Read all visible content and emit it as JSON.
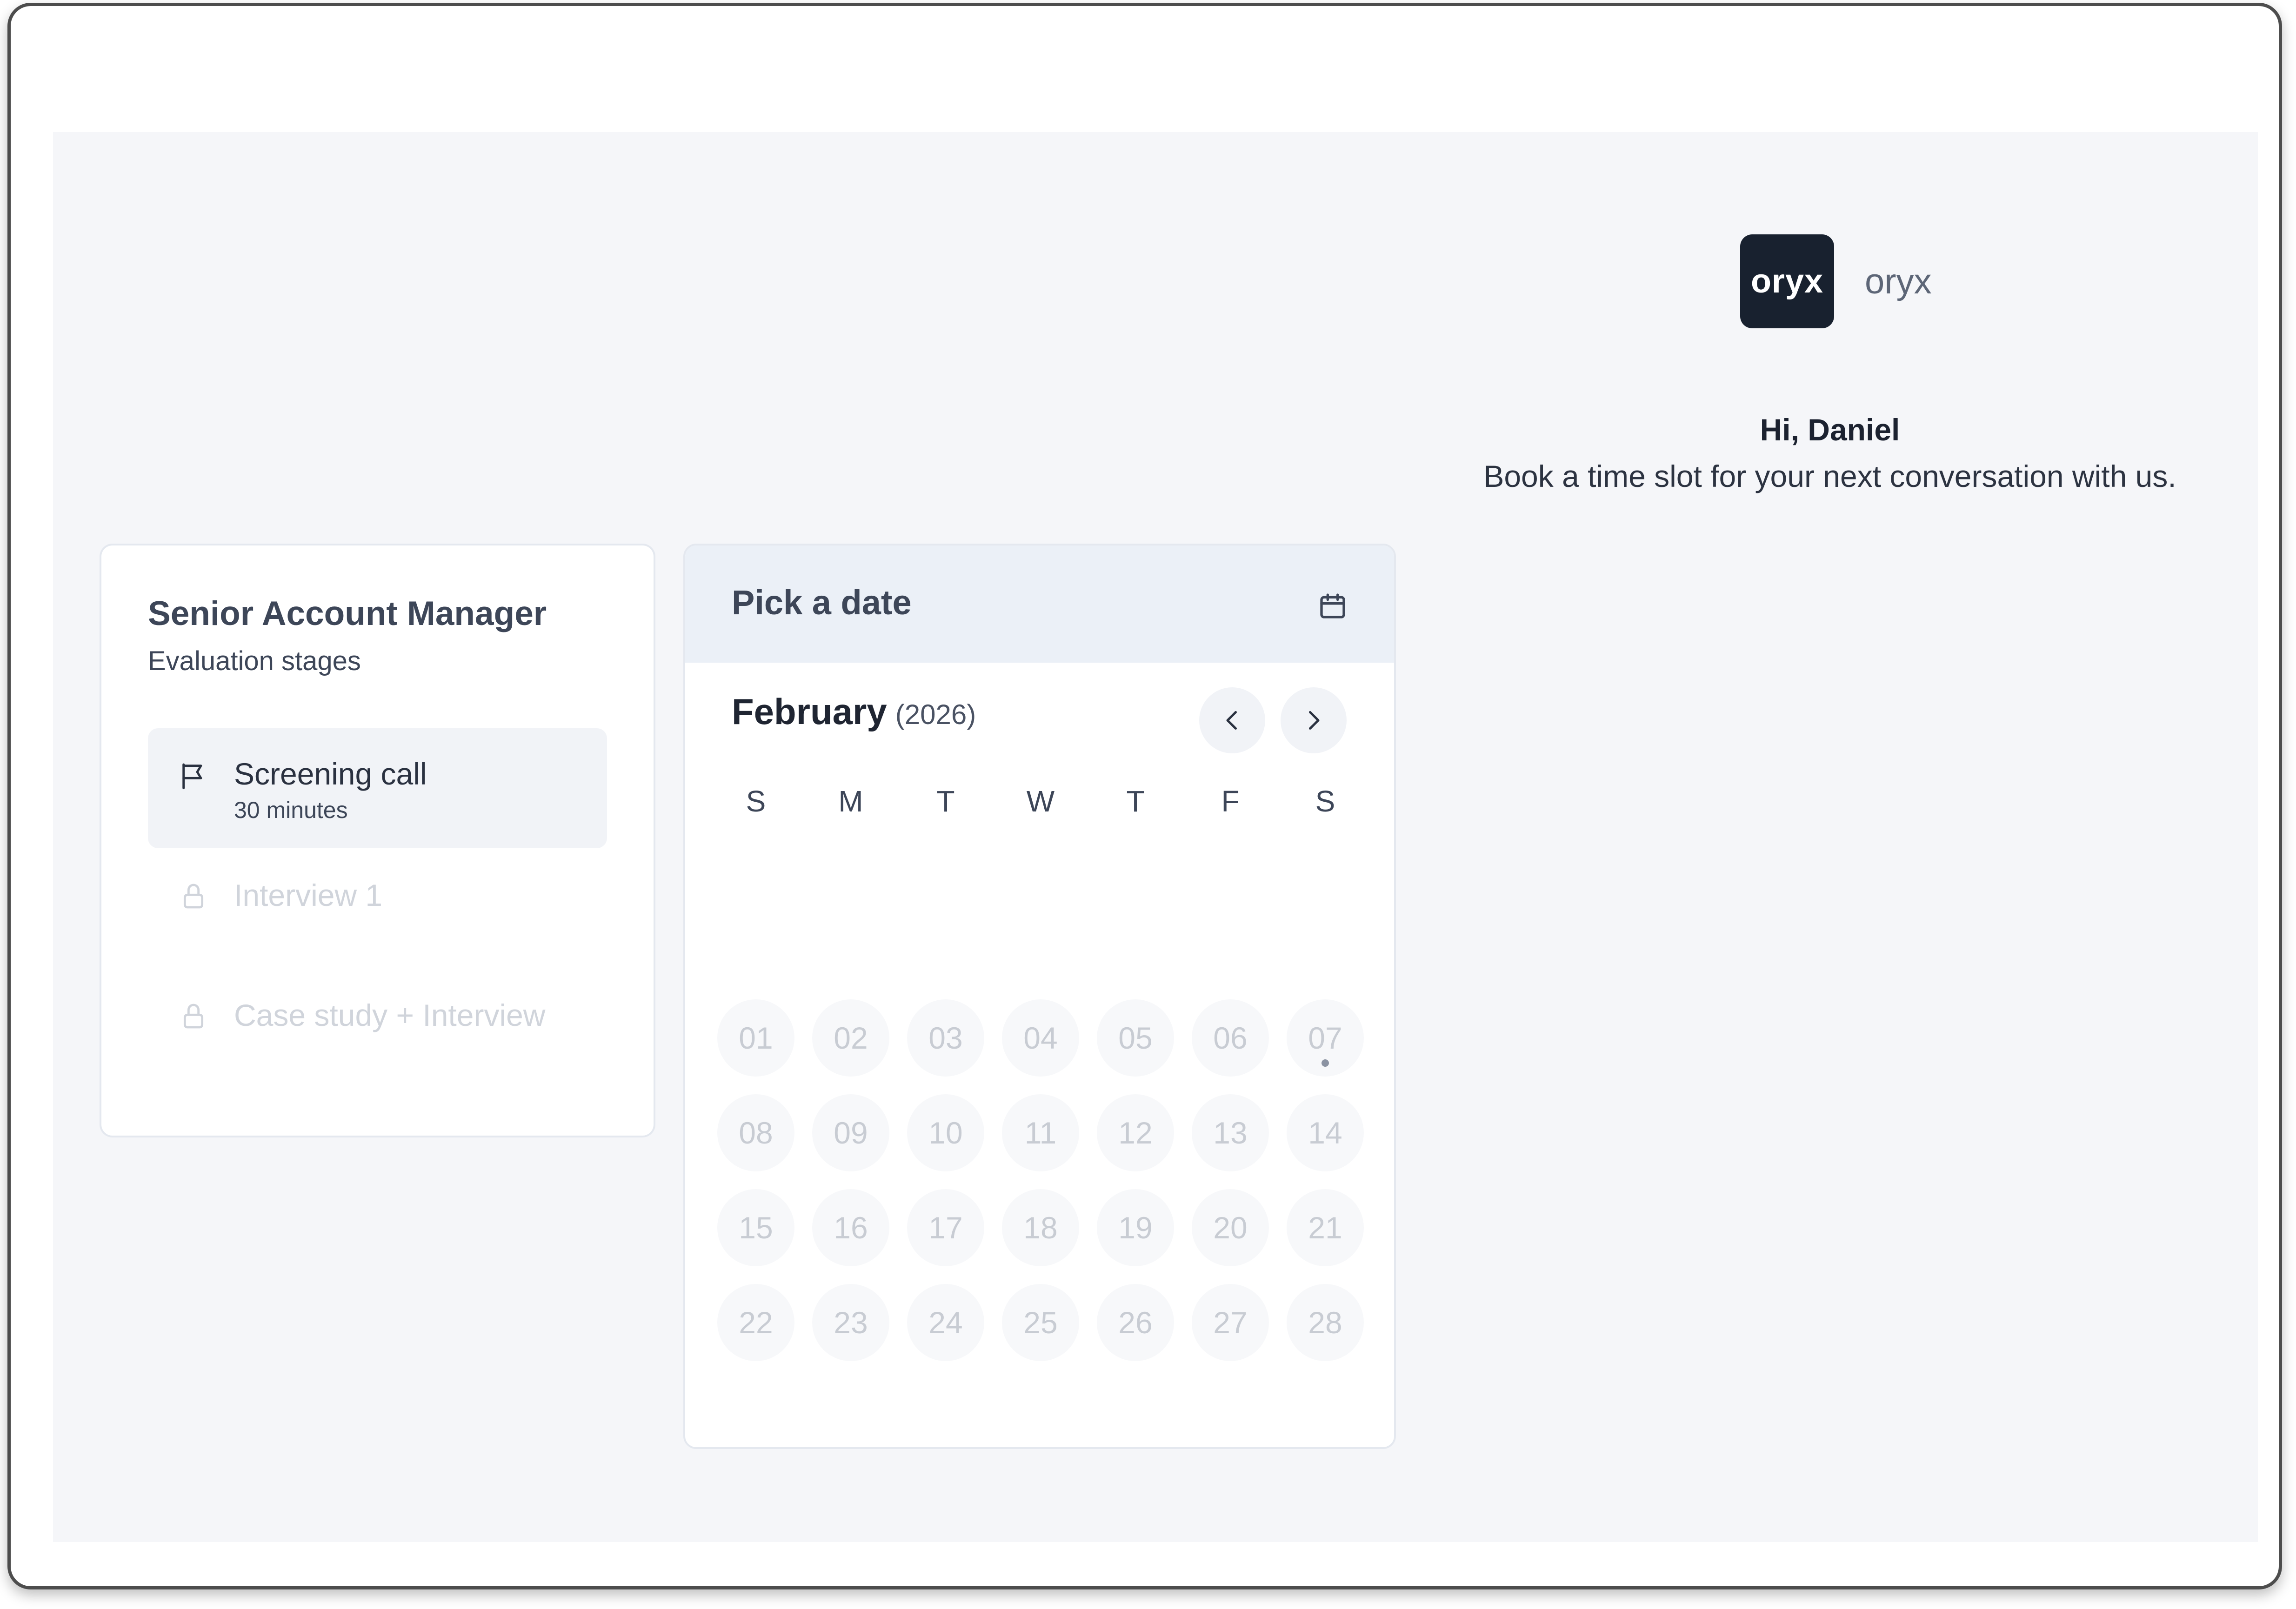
{
  "brand": {
    "logo_text": "oryx",
    "name": "oryx"
  },
  "greeting": {
    "title": "Hi, Daniel",
    "subtitle": "Book a time slot for your next conversation with us."
  },
  "stages": {
    "title": "Senior Account Manager",
    "subtitle": "Evaluation stages",
    "items": [
      {
        "label": "Screening call",
        "duration": "30 minutes",
        "icon": "flag-icon",
        "state": "active"
      },
      {
        "label": "Interview 1",
        "duration": "",
        "icon": "lock-icon",
        "state": "locked"
      },
      {
        "label": "Case study + Interview",
        "duration": "",
        "icon": "lock-icon",
        "state": "locked"
      }
    ]
  },
  "calendar": {
    "header_title": "Pick a date",
    "header_icon": "calendar-icon",
    "month": "February",
    "year": "(2026)",
    "prev_icon": "chevron-left-icon",
    "next_icon": "chevron-right-icon",
    "weekdays": [
      "S",
      "M",
      "T",
      "W",
      "T",
      "F",
      "S"
    ],
    "days": [
      "01",
      "02",
      "03",
      "04",
      "05",
      "06",
      "07",
      "08",
      "09",
      "10",
      "11",
      "12",
      "13",
      "14",
      "15",
      "16",
      "17",
      "18",
      "19",
      "20",
      "21",
      "22",
      "23",
      "24",
      "25",
      "26",
      "27",
      "28"
    ],
    "marked_day": "07"
  },
  "colors": {
    "background": "#f5f6f9",
    "logo_bg": "#18212f",
    "header_bg": "#ebf0f7",
    "disabled_text": "#c8ccd3",
    "active_stage_bg": "#f1f3f7"
  }
}
